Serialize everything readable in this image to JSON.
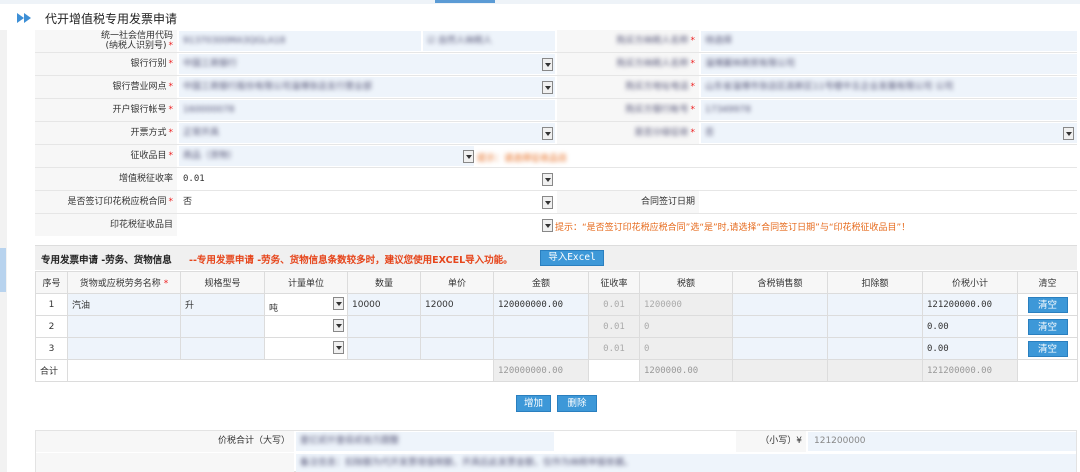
{
  "header": {
    "title": "代开增值税专用发票申请"
  },
  "form": {
    "credit_code_label": "统一社会信用代码\n(纳税人识别号)",
    "credit_code_value": "91370300MA3QGLA18",
    "credit_code_checkbox_label": "自然人纳税人",
    "r1_right_label": "购买方纳税人名称",
    "r1_right_value": "待选择",
    "bank_label": "银行行别",
    "bank_value": "中国工商银行",
    "r2_right_label": "购买方纳税人名称",
    "r2_right_value": "淄博翼林商贸有限公司",
    "branch_label": "银行营业网点",
    "branch_value": "中国工商银行股份有限公司淄博张店支行营业部",
    "r3_right_label": "购买方地址电话",
    "r3_right_value": "山东省淄博市张店区高新区11号楼中五企业发展有限公司 公司",
    "account_label": "开户银行帐号",
    "account_value": "160000078",
    "r4_right_label": "购买方银行帐号",
    "r4_right_value": "17349978",
    "method_label": "开票方式",
    "method_value": "正常开具",
    "r5_right_label": "是否分级征收",
    "r5_right_value": "否",
    "levy_label": "征收品目",
    "levy_value": "商品（货物）",
    "levy_hint": "提示：请选择征收品目",
    "vat_rate_label": "增值税征收率",
    "vat_rate_value": "0.01",
    "stamp_label": "是否签订印花税应税合同",
    "stamp_value": "否",
    "contract_date_label": "合同签订日期",
    "stamp_item_label": "印花税征收品目",
    "stamp_hint": "提示：“是否签订印花税应税合同”选“是”时,请选择“合同签订日期”与“印花税征收品目”！"
  },
  "section": {
    "title": "专用发票申请 -劳务、货物信息",
    "note": "--专用发票申请 -劳务、货物信息条数较多时，建议您使用EXCEL导入功能。",
    "import_button": "导入Excel"
  },
  "table": {
    "headers": {
      "seq": "序号",
      "name": "货物或应税劳务名称",
      "spec": "规格型号",
      "unit": "计量单位",
      "qty": "数量",
      "price": "单价",
      "amount": "金额",
      "rate": "征收率",
      "tax": "税额",
      "gross": "含税销售额",
      "deduct": "扣除额",
      "subtotal": "价税小计",
      "clear": "清空"
    },
    "rows": [
      {
        "seq": "1",
        "name": "汽油",
        "spec": "升",
        "unit": "吨",
        "qty": "10000",
        "price": "12000",
        "amount": "120000000.00",
        "rate": "0.01",
        "tax": "1200000",
        "subtotal": "121200000.00",
        "clear": "清空"
      },
      {
        "seq": "2",
        "name": "",
        "spec": "",
        "unit": "",
        "qty": "",
        "price": "",
        "amount": "",
        "rate": "0.01",
        "tax": "0",
        "subtotal": "0.00",
        "clear": "清空"
      },
      {
        "seq": "3",
        "name": "",
        "spec": "",
        "unit": "",
        "qty": "",
        "price": "",
        "amount": "",
        "rate": "0.01",
        "tax": "0",
        "subtotal": "0.00",
        "clear": "清空"
      }
    ],
    "total": {
      "label": "合计",
      "amount": "120000000.00",
      "tax": "1200000.00",
      "subtotal": "121200000.00"
    },
    "add_button": "增加",
    "delete_button": "删除"
  },
  "summary": {
    "total_upper_label": "价税合计（大写）",
    "total_upper_value": "壹亿贰仟壹佰贰拾万圆整",
    "total_lower_label": "（小写）¥",
    "total_lower_value": "121200000",
    "remark_value": "备注信息：扣除额为代开发票增值税额，开具后此发票金额，仅作为纳税申报依据。"
  }
}
